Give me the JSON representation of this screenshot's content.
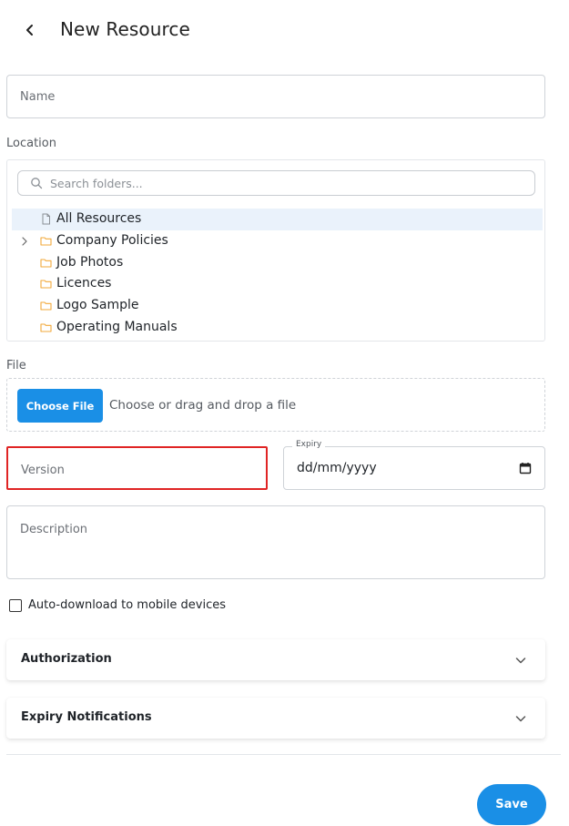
{
  "header": {
    "title": "New Resource",
    "back_icon": "chevron-left-icon"
  },
  "form": {
    "name_placeholder": "Name",
    "location_label": "Location",
    "search_placeholder": "Search folders...",
    "folders": [
      {
        "label": "All Resources",
        "icon": "file-icon",
        "selected": true,
        "expandable": false
      },
      {
        "label": "Company Policies",
        "icon": "folder-icon",
        "selected": false,
        "expandable": true
      },
      {
        "label": "Job Photos",
        "icon": "folder-icon",
        "selected": false,
        "expandable": false
      },
      {
        "label": "Licences",
        "icon": "folder-icon",
        "selected": false,
        "expandable": false
      },
      {
        "label": "Logo Sample",
        "icon": "folder-icon",
        "selected": false,
        "expandable": false
      },
      {
        "label": "Operating Manuals",
        "icon": "folder-icon",
        "selected": false,
        "expandable": false
      }
    ],
    "file_label": "File",
    "choose_file_label": "Choose File",
    "file_hint": "Choose or drag and drop a file",
    "version_placeholder": "Version",
    "expiry_label": "Expiry",
    "expiry_value": "dd/mm/yyyy",
    "description_placeholder": "Description",
    "auto_download_label": "Auto-download to mobile devices",
    "auto_download_checked": false
  },
  "sections": {
    "authorization_title": "Authorization",
    "expiry_notifications_title": "Expiry Notifications"
  },
  "footer": {
    "save_label": "Save"
  },
  "colors": {
    "accent": "#1a8fe6",
    "highlight": "#e02424",
    "folder_icon": "#f2a93b",
    "selected_row": "#eaf2fb"
  }
}
